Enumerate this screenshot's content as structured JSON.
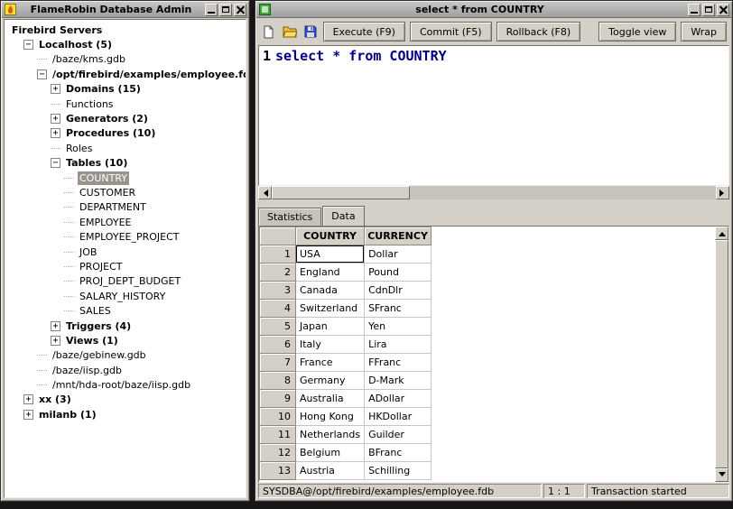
{
  "left_window": {
    "title": "FlameRobin Database Admin",
    "tree": [
      {
        "label": "Firebird Servers",
        "level": 0,
        "bold": true,
        "expander": "none"
      },
      {
        "label": "Localhost (5)",
        "level": 1,
        "bold": true,
        "expander": "minus"
      },
      {
        "label": "/baze/kms.gdb",
        "level": 2,
        "bold": false,
        "expander": "none"
      },
      {
        "label": "/opt/firebird/examples/employee.fdb",
        "level": 2,
        "bold": true,
        "expander": "minus"
      },
      {
        "label": "Domains (15)",
        "level": 3,
        "bold": true,
        "expander": "plus"
      },
      {
        "label": "Functions",
        "level": 3,
        "bold": false,
        "expander": "none"
      },
      {
        "label": "Generators (2)",
        "level": 3,
        "bold": true,
        "expander": "plus"
      },
      {
        "label": "Procedures (10)",
        "level": 3,
        "bold": true,
        "expander": "plus"
      },
      {
        "label": "Roles",
        "level": 3,
        "bold": false,
        "expander": "none"
      },
      {
        "label": "Tables (10)",
        "level": 3,
        "bold": true,
        "expander": "minus"
      },
      {
        "label": "COUNTRY",
        "level": 4,
        "bold": false,
        "expander": "none",
        "selected": true
      },
      {
        "label": "CUSTOMER",
        "level": 4,
        "bold": false,
        "expander": "none"
      },
      {
        "label": "DEPARTMENT",
        "level": 4,
        "bold": false,
        "expander": "none"
      },
      {
        "label": "EMPLOYEE",
        "level": 4,
        "bold": false,
        "expander": "none"
      },
      {
        "label": "EMPLOYEE_PROJECT",
        "level": 4,
        "bold": false,
        "expander": "none"
      },
      {
        "label": "JOB",
        "level": 4,
        "bold": false,
        "expander": "none"
      },
      {
        "label": "PROJECT",
        "level": 4,
        "bold": false,
        "expander": "none"
      },
      {
        "label": "PROJ_DEPT_BUDGET",
        "level": 4,
        "bold": false,
        "expander": "none"
      },
      {
        "label": "SALARY_HISTORY",
        "level": 4,
        "bold": false,
        "expander": "none"
      },
      {
        "label": "SALES",
        "level": 4,
        "bold": false,
        "expander": "none"
      },
      {
        "label": "Triggers (4)",
        "level": 3,
        "bold": true,
        "expander": "plus"
      },
      {
        "label": "Views (1)",
        "level": 3,
        "bold": true,
        "expander": "plus"
      },
      {
        "label": "/baze/gebinew.gdb",
        "level": 2,
        "bold": false,
        "expander": "none"
      },
      {
        "label": "/baze/iisp.gdb",
        "level": 2,
        "bold": false,
        "expander": "none"
      },
      {
        "label": "/mnt/hda-root/baze/iisp.gdb",
        "level": 2,
        "bold": false,
        "expander": "none"
      },
      {
        "label": "xx (3)",
        "level": 1,
        "bold": true,
        "expander": "plus"
      },
      {
        "label": "milanb (1)",
        "level": 1,
        "bold": true,
        "expander": "plus"
      }
    ]
  },
  "right_window": {
    "title": "select * from COUNTRY",
    "toolbar": {
      "execute": "Execute (F9)",
      "commit": "Commit (F5)",
      "rollback": "Rollback (F8)",
      "toggle_view": "Toggle view",
      "wrap": "Wrap"
    },
    "editor": {
      "line_number": "1",
      "sql": "select * from COUNTRY"
    },
    "tabs": [
      {
        "label": "Statistics",
        "active": false
      },
      {
        "label": "Data",
        "active": true
      }
    ],
    "grid": {
      "columns": [
        "COUNTRY",
        "CURRENCY"
      ],
      "focus_cell": {
        "row": 0,
        "col": 0
      },
      "rows": [
        {
          "num": "1",
          "country": "USA",
          "currency": "Dollar"
        },
        {
          "num": "2",
          "country": "England",
          "currency": "Pound"
        },
        {
          "num": "3",
          "country": "Canada",
          "currency": "CdnDlr"
        },
        {
          "num": "4",
          "country": "Switzerland",
          "currency": "SFranc"
        },
        {
          "num": "5",
          "country": "Japan",
          "currency": "Yen"
        },
        {
          "num": "6",
          "country": "Italy",
          "currency": "Lira"
        },
        {
          "num": "7",
          "country": "France",
          "currency": "FFranc"
        },
        {
          "num": "8",
          "country": "Germany",
          "currency": "D-Mark"
        },
        {
          "num": "9",
          "country": "Australia",
          "currency": "ADollar"
        },
        {
          "num": "10",
          "country": "Hong Kong",
          "currency": "HKDollar"
        },
        {
          "num": "11",
          "country": "Netherlands",
          "currency": "Guilder"
        },
        {
          "num": "12",
          "country": "Belgium",
          "currency": "BFranc"
        },
        {
          "num": "13",
          "country": "Austria",
          "currency": "Schilling"
        }
      ]
    },
    "statusbar": {
      "connection": "SYSDBA@/opt/firebird/examples/employee.fdb",
      "position": "1 : 1",
      "transaction": "Transaction started"
    }
  },
  "colors": {
    "chrome": "#d4d0c8",
    "sql_text": "#000080",
    "selection_bg": "#98948c",
    "titlebar": "#a8a8a8"
  },
  "icons": {
    "flamerobin": "flame-logo",
    "window": "green-app-icon",
    "minimize": "underscore-bar",
    "maximize": "square-outline",
    "close": "x-cross",
    "new_file": "blank-page",
    "open_file": "folder",
    "save_file": "floppy-disk",
    "expand": "plus-box",
    "collapse": "minus-box"
  }
}
